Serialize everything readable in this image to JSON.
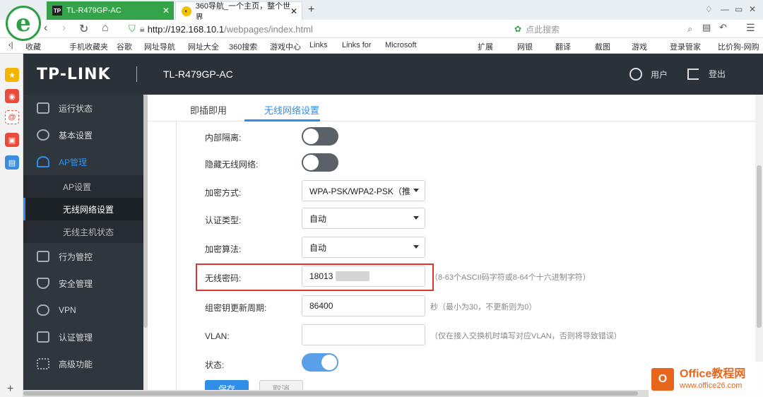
{
  "browser": {
    "tabs": [
      {
        "title": "TL-R479GP-AC",
        "favicon": "TP"
      },
      {
        "title": "360导航_一个主页，整个世界",
        "favicon": "360"
      }
    ],
    "url_host": "http://192.168.10.1",
    "url_path": "/webpages/index.html",
    "search_placeholder": "点此搜索",
    "bookmarks": [
      "收藏",
      "手机收藏夹",
      "谷歌",
      "网址导航",
      "网址大全",
      "360搜索",
      "游戏中心",
      "Links",
      "Links for",
      "Microsoft"
    ],
    "bookmarks_right": [
      "扩展",
      "网银",
      "翻译",
      "截图",
      "游戏",
      "登录管家",
      "比价狗-网购"
    ]
  },
  "header": {
    "brand": "TP-LINK",
    "model": "TL-R479GP-AC",
    "user_label": "用户",
    "logout_label": "登出"
  },
  "menu": {
    "items": [
      {
        "label": "运行状态",
        "icon": "monitor-icon"
      },
      {
        "label": "基本设置",
        "icon": "gear-icon"
      },
      {
        "label": "AP管理",
        "icon": "wifi-antenna-icon",
        "active": true
      },
      {
        "label": "行为管控",
        "icon": "control-icon"
      },
      {
        "label": "安全管理",
        "icon": "shield-icon"
      },
      {
        "label": "VPN",
        "icon": "vpn-cloud-icon"
      },
      {
        "label": "认证管理",
        "icon": "id-badge-icon"
      },
      {
        "label": "高级功能",
        "icon": "grid-icon"
      }
    ],
    "subitems": [
      {
        "label": "AP设置"
      },
      {
        "label": "无线网络设置",
        "selected": true
      },
      {
        "label": "无线主机状态"
      }
    ]
  },
  "content": {
    "tabs": [
      "即插即用",
      "无线网络设置"
    ],
    "active_tab": 1,
    "fields": {
      "isolation_label": "内部隔离:",
      "isolation_on": false,
      "hide_ssid_label": "隐藏无线网络:",
      "hide_ssid_on": false,
      "encryption_label": "加密方式:",
      "encryption_value": "WPA-PSK/WPA2-PSK（推",
      "auth_label": "认证类型:",
      "auth_value": "自动",
      "algo_label": "加密算法:",
      "algo_value": "自动",
      "password_label": "无线密码:",
      "password_value": "18013",
      "password_hint": "（8-63个ASCII码字符或8-64个十六进制字符）",
      "rekey_label": "组密钥更新周期:",
      "rekey_value": "86400",
      "rekey_hint": "秒（最小为30，不更新则为0）",
      "vlan_label": "VLAN:",
      "vlan_value": "",
      "vlan_hint": "（仅在接入交换机时填写对应VLAN，否则将导致错误）",
      "status_label": "状态:",
      "status_on": true
    },
    "save_label": "保存",
    "cancel_label": "取消"
  },
  "watermark": {
    "title": "Office教程网",
    "url": "www.office26.com"
  },
  "colors": {
    "accent": "#2f8fe8",
    "header_bg": "#2a3138",
    "menu_bg": "#2f363d",
    "highlight_border": "#d9362f",
    "tab_active": "#35a34a"
  }
}
